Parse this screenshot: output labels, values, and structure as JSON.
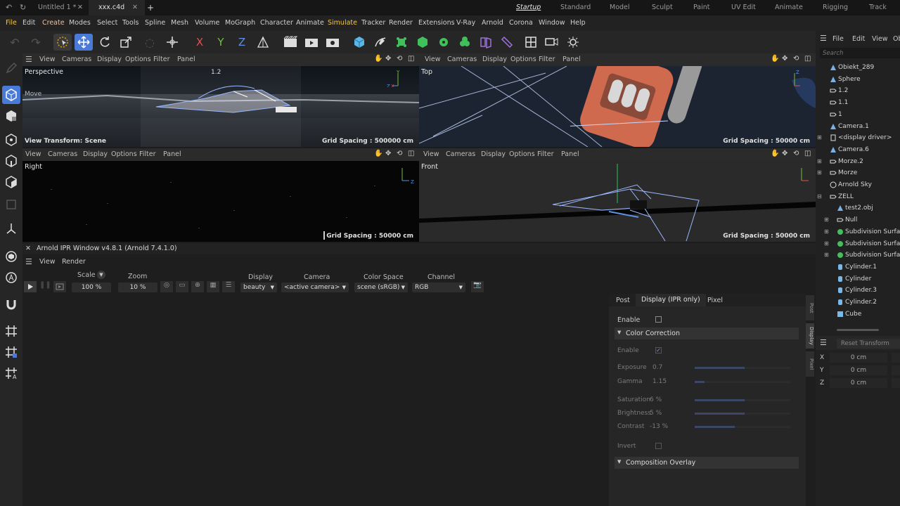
{
  "file_tabs": {
    "untitled": "Untitled 1 *",
    "current": "xxx.c4d",
    "add": "+"
  },
  "layouts": [
    "Startup",
    "Standard",
    "Model",
    "Sculpt",
    "Paint",
    "UV Edit",
    "Animate",
    "Rigging",
    "Track"
  ],
  "menu": [
    "File",
    "Edit",
    "Create",
    "Modes",
    "Select",
    "Tools",
    "Spline",
    "Mesh",
    "Volume",
    "MoGraph",
    "Character",
    "Animate",
    "Simulate",
    "Tracker",
    "Render",
    "Extensions",
    "V-Ray",
    "Arnold",
    "Corona",
    "Window",
    "Help"
  ],
  "toolbar": {
    "x_label": "X",
    "y_label": "Y",
    "z_label": "Z"
  },
  "viewport_menu": [
    "View",
    "Cameras",
    "Display",
    "Options",
    "Filter",
    "Panel"
  ],
  "viewports": {
    "perspective": {
      "title": "Perspective",
      "move_label": "Move",
      "zoom_label": "1.2",
      "view_transform": "View Transform: Scene",
      "grid": "Grid Spacing : 500000 cm"
    },
    "top": {
      "title": "Top",
      "grid": "Grid Spacing : 50000 cm"
    },
    "right": {
      "title": "Right",
      "grid": "Grid Spacing : 50000 cm"
    },
    "front": {
      "title": "Front",
      "grid": "Grid Spacing : 50000 cm"
    }
  },
  "axes": {
    "x": "X",
    "y": "Y",
    "z": "Z"
  },
  "ipr": {
    "title": "Arnold IPR Window v4.8.1 (Arnold 7.4.1.0)",
    "menu": [
      "View",
      "Render"
    ],
    "scale_label": "Scale",
    "scale_value": "100 %",
    "zoom_label": "Zoom",
    "zoom_value": "10 %",
    "display_label": "Display",
    "display_value": "beauty",
    "camera_label": "Camera",
    "camera_value": "<active camera>",
    "colorspace_label": "Color Space",
    "colorspace_value": "scene (sRGB)",
    "channel_label": "Channel",
    "channel_value": "RGB",
    "tabs": [
      "Post",
      "Display (IPR only)",
      "Pixel"
    ],
    "side_tabs": [
      "Post",
      "Display",
      "Pixel"
    ],
    "enable_label": "Enable",
    "color_correction": "Color Correction",
    "cc_enable": "Enable",
    "params": [
      {
        "label": "Exposure",
        "value": "0.7",
        "fill": 0.52
      },
      {
        "label": "Gamma",
        "value": "1.15",
        "fill": 0.1
      },
      {
        "label": "Saturation",
        "value": "6 %",
        "fill": 0.52
      },
      {
        "label": "Brightness",
        "value": "5 %",
        "fill": 0.52
      },
      {
        "label": "Contrast",
        "value": "-13 %",
        "fill": 0.42
      }
    ],
    "invert_label": "Invert",
    "composition_overlay": "Composition Overlay"
  },
  "object_manager": {
    "menu": [
      "File",
      "Edit",
      "View",
      "Ob"
    ],
    "search_placeholder": "Search",
    "objects": [
      {
        "name": "Obiekt_289",
        "icon": "polygon-object-icon",
        "indent": 0
      },
      {
        "name": "Sphere",
        "icon": "sphere-icon",
        "indent": 0
      },
      {
        "name": "1.2",
        "icon": "null-object-icon",
        "indent": 0
      },
      {
        "name": "1.1",
        "icon": "null-object-icon",
        "indent": 0
      },
      {
        "name": "1",
        "icon": "null-object-icon",
        "indent": 0
      },
      {
        "name": "Camera.1",
        "icon": "camera-icon",
        "indent": 0
      },
      {
        "name": "<display driver>",
        "icon": "driver-icon",
        "indent": 0
      },
      {
        "name": "Camera.6",
        "icon": "camera-icon",
        "indent": 0
      },
      {
        "name": "Morze.2",
        "icon": "null-object-icon",
        "indent": 0
      },
      {
        "name": "Morze",
        "icon": "null-object-icon",
        "indent": 0
      },
      {
        "name": "Arnold Sky",
        "icon": "sky-icon",
        "indent": 0
      },
      {
        "name": "ZELL",
        "icon": "null-object-icon",
        "indent": 0
      },
      {
        "name": "test2.obj",
        "icon": "polygon-object-icon",
        "indent": 1
      },
      {
        "name": "Null",
        "icon": "null-object-icon",
        "indent": 1
      },
      {
        "name": "Subdivision Surface",
        "icon": "subdivision-icon",
        "indent": 1
      },
      {
        "name": "Subdivision Surface",
        "icon": "subdivision-icon",
        "indent": 1
      },
      {
        "name": "Subdivision Surface",
        "icon": "subdivision-icon",
        "indent": 1
      },
      {
        "name": "Cylinder.1",
        "icon": "cylinder-icon",
        "indent": 1
      },
      {
        "name": "Cylinder",
        "icon": "cylinder-icon",
        "indent": 1
      },
      {
        "name": "Cylinder.3",
        "icon": "cylinder-icon",
        "indent": 1
      },
      {
        "name": "Cylinder.2",
        "icon": "cylinder-icon",
        "indent": 1
      },
      {
        "name": "Cube",
        "icon": "cube-icon",
        "indent": 1
      }
    ]
  },
  "coordinates": {
    "reset_label": "Reset Transform",
    "rows": [
      {
        "axis": "X",
        "value": "0 cm"
      },
      {
        "axis": "Y",
        "value": "0 cm"
      },
      {
        "axis": "Z",
        "value": "0 cm"
      }
    ]
  },
  "colors": {
    "accent_blue": "#4a7ad8",
    "active_menu": "#f5c542",
    "bg": "#1c1c1c"
  }
}
